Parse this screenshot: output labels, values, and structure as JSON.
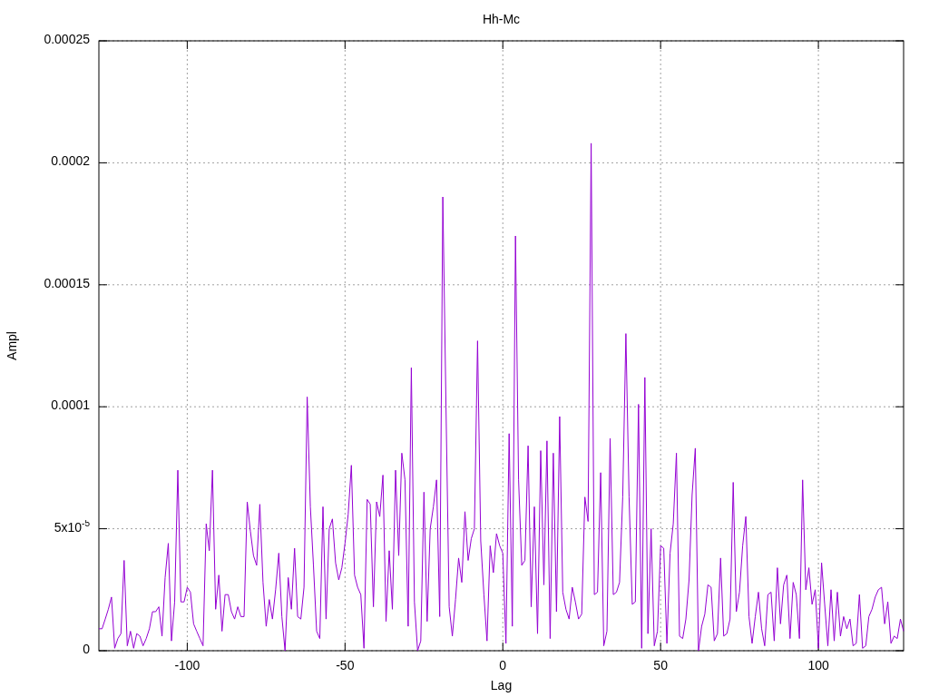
{
  "plot": {
    "chart_data": {
      "type": "line",
      "title": "Hh-Mc",
      "xlabel": "Lag",
      "ylabel": "Ampl",
      "xlim": [
        -128,
        127
      ],
      "ylim": [
        0,
        0.00025
      ],
      "xticks": [
        -100,
        -50,
        0,
        50,
        100
      ],
      "yticks": [
        {
          "value": 0,
          "label": "0"
        },
        {
          "value": 5e-05,
          "label": "5x10$^{-5}$"
        },
        {
          "value": 0.0001,
          "label": "0.0001"
        },
        {
          "value": 0.00015,
          "label": "0.00015"
        },
        {
          "value": 0.0002,
          "label": "0.0002"
        },
        {
          "value": 0.00025,
          "label": "0.00025"
        }
      ],
      "x": [
        -128,
        -127,
        -126,
        -125,
        -124,
        -123,
        -122,
        -121,
        -120,
        -119,
        -118,
        -117,
        -116,
        -115,
        -114,
        -113,
        -112,
        -111,
        -110,
        -109,
        -108,
        -107,
        -106,
        -105,
        -104,
        -103,
        -102,
        -101,
        -100,
        -99,
        -98,
        -97,
        -96,
        -95,
        -94,
        -93,
        -92,
        -91,
        -90,
        -89,
        -88,
        -87,
        -86,
        -85,
        -84,
        -83,
        -82,
        -81,
        -80,
        -79,
        -78,
        -77,
        -76,
        -75,
        -74,
        -73,
        -72,
        -71,
        -70,
        -69,
        -68,
        -67,
        -66,
        -65,
        -64,
        -63,
        -62,
        -61,
        -60,
        -59,
        -58,
        -57,
        -56,
        -55,
        -54,
        -53,
        -52,
        -51,
        -50,
        -49,
        -48,
        -47,
        -46,
        -45,
        -44,
        -43,
        -42,
        -41,
        -40,
        -39,
        -38,
        -37,
        -36,
        -35,
        -34,
        -33,
        -32,
        -31,
        -30,
        -29,
        -28,
        -27,
        -26,
        -25,
        -24,
        -23,
        -22,
        -21,
        -20,
        -19,
        -18,
        -17,
        -16,
        -15,
        -14,
        -13,
        -12,
        -11,
        -10,
        -9,
        -8,
        -7,
        -6,
        -5,
        -4,
        -3,
        -2,
        -1,
        0,
        1,
        2,
        3,
        4,
        5,
        6,
        7,
        8,
        9,
        10,
        11,
        12,
        13,
        14,
        15,
        16,
        17,
        18,
        19,
        20,
        21,
        22,
        23,
        24,
        25,
        26,
        27,
        28,
        29,
        30,
        31,
        32,
        33,
        34,
        35,
        36,
        37,
        38,
        39,
        40,
        41,
        42,
        43,
        44,
        45,
        46,
        47,
        48,
        49,
        50,
        51,
        52,
        53,
        54,
        55,
        56,
        57,
        58,
        59,
        60,
        61,
        62,
        63,
        64,
        65,
        66,
        67,
        68,
        69,
        70,
        71,
        72,
        73,
        74,
        75,
        76,
        77,
        78,
        79,
        80,
        81,
        82,
        83,
        84,
        85,
        86,
        87,
        88,
        89,
        90,
        91,
        92,
        93,
        94,
        95,
        96,
        97,
        98,
        99,
        100,
        101,
        102,
        103,
        104,
        105,
        106,
        107,
        108,
        109,
        110,
        111,
        112,
        113,
        114,
        115,
        116,
        117,
        118,
        119,
        120,
        121,
        122,
        123,
        124,
        125,
        126,
        127
      ],
      "grid": true,
      "series": [
        {
          "color": "#9400d3",
          "values": [
            9e-06,
            9e-06,
            1.3e-05,
            1.7e-05,
            2.2e-05,
            1e-06,
            5e-06,
            7e-06,
            3.7e-05,
            2e-06,
            8e-06,
            1e-06,
            7e-06,
            6e-06,
            2e-06,
            5e-06,
            9e-06,
            1.6e-05,
            1.6e-05,
            1.8e-05,
            6e-06,
            3e-05,
            4.4e-05,
            4e-06,
            2e-05,
            7.4e-05,
            2e-05,
            2e-05,
            2.6e-05,
            2.4e-05,
            1.1e-05,
            8e-06,
            5e-06,
            2e-06,
            5.2e-05,
            4.1e-05,
            7.4e-05,
            1.7e-05,
            3.1e-05,
            8e-06,
            2.3e-05,
            2.3e-05,
            1.6e-05,
            1.3e-05,
            1.8e-05,
            1.4e-05,
            1.4e-05,
            6.1e-05,
            4.9e-05,
            3.9e-05,
            3.5e-05,
            6e-05,
            2.8e-05,
            1e-05,
            2.1e-05,
            1.3e-05,
            2.5e-05,
            4e-05,
            1.4e-05,
            0.0,
            3e-05,
            1.7e-05,
            4.2e-05,
            1.4e-05,
            1.3e-05,
            2.6e-05,
            0.000104,
            5.9e-05,
            3.5e-05,
            8e-06,
            5e-06,
            5.9e-05,
            1.3e-05,
            5e-05,
            5.4e-05,
            3.6e-05,
            2.9e-05,
            3.4e-05,
            4.4e-05,
            5.6e-05,
            7.6e-05,
            3.1e-05,
            2.6e-05,
            2.3e-05,
            1e-06,
            6.2e-05,
            6e-05,
            1.8e-05,
            6.1e-05,
            5.5e-05,
            7.2e-05,
            1.2e-05,
            4.1e-05,
            1.7e-05,
            7.4e-05,
            3.9e-05,
            8.1e-05,
            7e-05,
            1e-05,
            0.000116,
            2e-05,
            0.0,
            4e-06,
            6.5e-05,
            1.2e-05,
            5e-05,
            5.9e-05,
            7e-05,
            1.4e-05,
            0.000186,
            0.0001,
            1.8e-05,
            6e-06,
            2.1e-05,
            3.8e-05,
            2.8e-05,
            5.7e-05,
            3.7e-05,
            4.6e-05,
            5e-05,
            0.000127,
            4.5e-05,
            2.3e-05,
            4e-06,
            4.3e-05,
            3.2e-05,
            4.8e-05,
            4.3e-05,
            4e-05,
            3e-06,
            8.9e-05,
            1e-05,
            0.00017,
            7e-05,
            3.5e-05,
            3.7e-05,
            8.4e-05,
            1.8e-05,
            5.9e-05,
            7e-06,
            8.2e-05,
            2.7e-05,
            8.6e-05,
            5e-06,
            8.1e-05,
            1.6e-05,
            9.6e-05,
            2.4e-05,
            1.7e-05,
            1.3e-05,
            2.6e-05,
            2e-05,
            1.3e-05,
            1.5e-05,
            6.3e-05,
            5.3e-05,
            0.000208,
            2.3e-05,
            2.4e-05,
            7.3e-05,
            2e-06,
            8e-06,
            8.7e-05,
            2.3e-05,
            2.4e-05,
            2.8e-05,
            6.3e-05,
            0.00013,
            6.3e-05,
            1.9e-05,
            2e-05,
            0.000101,
            1e-06,
            0.000112,
            7e-06,
            5e-05,
            2e-06,
            8e-06,
            4.3e-05,
            4.2e-05,
            3e-06,
            4e-05,
            5.2e-05,
            8.1e-05,
            6e-06,
            5e-06,
            1.3e-05,
            2.9e-05,
            6.4e-05,
            8.3e-05,
            0.0,
            1e-05,
            1.5e-05,
            2.7e-05,
            2.6e-05,
            4e-06,
            7e-06,
            3.8e-05,
            6e-06,
            7e-06,
            1.3e-05,
            6.9e-05,
            1.6e-05,
            2.4e-05,
            4.3e-05,
            5.5e-05,
            1.4e-05,
            3e-06,
            1.4e-05,
            2.4e-05,
            9e-06,
            2e-06,
            2.3e-05,
            2.4e-05,
            4e-06,
            3.4e-05,
            1.1e-05,
            2.7e-05,
            3.1e-05,
            5e-06,
            2.8e-05,
            2.3e-05,
            5e-06,
            7e-05,
            2.5e-05,
            3.4e-05,
            1.9e-05,
            2.5e-05,
            1e-06,
            3.6e-05,
            1.9e-05,
            2e-06,
            2.5e-05,
            4e-06,
            2.4e-05,
            6e-06,
            1.4e-05,
            9e-06,
            1.3e-05,
            2e-06,
            3e-06,
            2.3e-05,
            1e-06,
            2e-06,
            1.4e-05,
            1.7e-05,
            2.2e-05,
            2.5e-05,
            2.6e-05,
            1.1e-05,
            2e-05,
            3e-06,
            6e-06,
            5e-06,
            1.3e-05,
            8e-06
          ]
        }
      ]
    }
  }
}
